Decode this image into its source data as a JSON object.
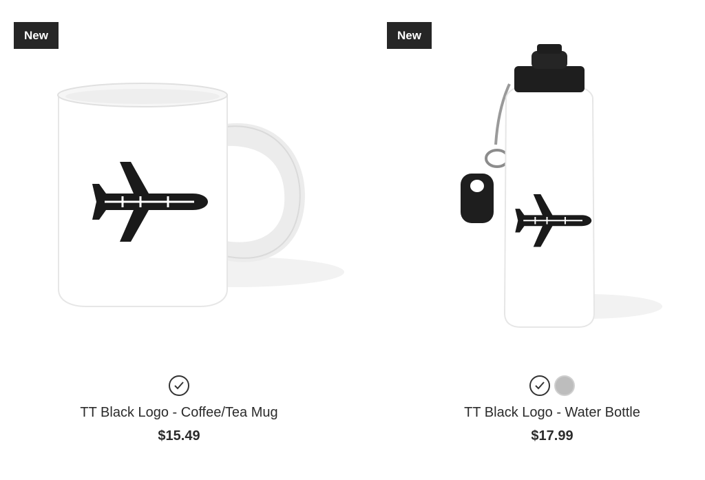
{
  "products": [
    {
      "badge": "New",
      "title": "TT Black Logo - Coffee/Tea Mug",
      "price": "$15.49",
      "product_type": "mug",
      "logo_icon": "airplane-icon",
      "colors": [
        {
          "name": "white",
          "hex": "#ffffff",
          "selected": true
        }
      ]
    },
    {
      "badge": "New",
      "title": "TT Black Logo - Water Bottle",
      "price": "$17.99",
      "product_type": "water-bottle",
      "logo_icon": "airplane-icon",
      "colors": [
        {
          "name": "white",
          "hex": "#ffffff",
          "selected": true
        },
        {
          "name": "silver",
          "hex": "#bdbdbd",
          "selected": false
        }
      ]
    }
  ],
  "theme": {
    "badge_bg": "#262626",
    "badge_text": "#ffffff",
    "text": "#2b2b2b",
    "logo": "#1a1a1a"
  }
}
